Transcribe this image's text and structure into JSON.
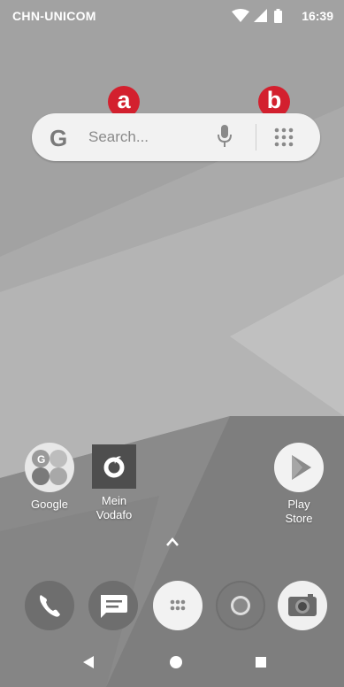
{
  "status_bar": {
    "carrier": "CHN-UNICOM",
    "time": "16:39",
    "icons": [
      "wifi-icon",
      "signal-icon",
      "battery-icon"
    ]
  },
  "search_widget": {
    "logo": "G",
    "placeholder": "Search...",
    "icons": [
      "google-logo",
      "mic-icon",
      "app-drawer-icon"
    ]
  },
  "annotations": {
    "a": "a",
    "b": "b"
  },
  "home_apps": [
    {
      "label": "Google",
      "icon": "google-folder-icon"
    },
    {
      "label": "Mein\nVodafo",
      "label_line1": "Mein",
      "label_line2": "Vodafo",
      "icon": "vodafone-icon"
    },
    {
      "label_line1": "Play",
      "label_line2": "Store",
      "icon": "play-store-icon"
    }
  ],
  "dock": [
    {
      "name": "phone",
      "icon": "phone-icon"
    },
    {
      "name": "messages",
      "icon": "messages-icon"
    },
    {
      "name": "all-apps",
      "icon": "apps-grid-icon"
    },
    {
      "name": "chrome",
      "icon": "chrome-icon"
    },
    {
      "name": "camera",
      "icon": "camera-icon"
    }
  ],
  "nav": [
    "back-icon",
    "home-icon",
    "recents-icon"
  ],
  "colors": {
    "badge": "#d3202e",
    "searchbar": "#f2f2f2"
  }
}
